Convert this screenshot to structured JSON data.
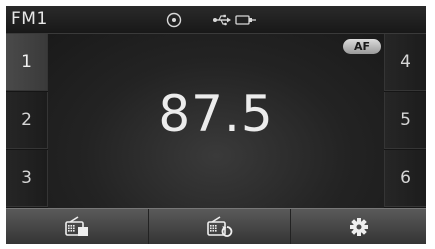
{
  "status": {
    "band": "FM1",
    "icons": [
      "disc-icon",
      "usb-icon",
      "aux-plug-icon"
    ]
  },
  "display": {
    "frequency": "87.5",
    "af_badge": "AF"
  },
  "presets": {
    "left": [
      "1",
      "2",
      "3"
    ],
    "right": [
      "4",
      "5",
      "6"
    ],
    "active": "1"
  },
  "bottom_bar": {
    "buttons": [
      "radio-list-icon",
      "radio-scan-icon",
      "settings-gear-icon"
    ]
  },
  "colors": {
    "background": "#151515",
    "text": "#ececec",
    "bottom_bar": "#4a4a4a"
  }
}
